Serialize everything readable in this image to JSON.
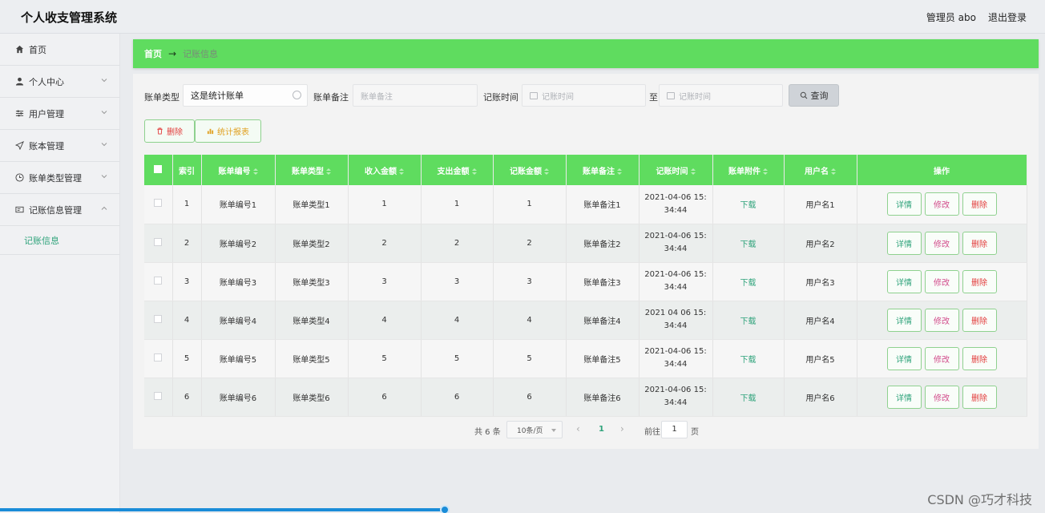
{
  "header": {
    "title": "个人收支管理系统",
    "admin": "管理员 abo",
    "logout": "退出登录"
  },
  "sidebar": {
    "items": [
      {
        "label": "首页",
        "icon": "home-icon"
      },
      {
        "label": "个人中心",
        "icon": "user-icon"
      },
      {
        "label": "用户管理",
        "icon": "sliders-icon"
      },
      {
        "label": "账本管理",
        "icon": "send-icon"
      },
      {
        "label": "账单类型管理",
        "icon": "clock-icon"
      },
      {
        "label": "记账信息管理",
        "icon": "card-icon"
      }
    ],
    "sub_item": "记账信息"
  },
  "breadcrumb": {
    "home": "首页",
    "arrow": "→",
    "current": "记账信息"
  },
  "search": {
    "type_label": "账单类型",
    "type_value": "这是统计账单",
    "remark_label": "账单备注",
    "remark_placeholder": "账单备注",
    "time_label": "记账时间",
    "time_start_placeholder": "记账时间",
    "to_label": "至",
    "time_end_placeholder": "记账时间",
    "query_label": "查询"
  },
  "actions": {
    "delete_label": "删除",
    "stats_label": "统计报表"
  },
  "table": {
    "headers": [
      "索引",
      "账单编号",
      "账单类型",
      "收入金额",
      "支出金额",
      "记账金额",
      "账单备注",
      "记账时间",
      "账单附件",
      "用户名",
      "操作"
    ],
    "rows": [
      {
        "index": "1",
        "no": "账单编号1",
        "type": "账单类型1",
        "income": "1",
        "expense": "1",
        "amount": "1",
        "remark": "账单备注1",
        "time1": "2021-04-06 15:",
        "time2": "34:44",
        "attach": "下载",
        "user": "用户名1"
      },
      {
        "index": "2",
        "no": "账单编号2",
        "type": "账单类型2",
        "income": "2",
        "expense": "2",
        "amount": "2",
        "remark": "账单备注2",
        "time1": "2021-04-06 15:",
        "time2": "34:44",
        "attach": "下载",
        "user": "用户名2"
      },
      {
        "index": "3",
        "no": "账单编号3",
        "type": "账单类型3",
        "income": "3",
        "expense": "3",
        "amount": "3",
        "remark": "账单备注3",
        "time1": "2021-04-06 15:",
        "time2": "34:44",
        "attach": "下载",
        "user": "用户名3"
      },
      {
        "index": "4",
        "no": "账单编号4",
        "type": "账单类型4",
        "income": "4",
        "expense": "4",
        "amount": "4",
        "remark": "账单备注4",
        "time1": "2021 04 06 15:",
        "time2": "34:44",
        "attach": "下载",
        "user": "用户名4"
      },
      {
        "index": "5",
        "no": "账单编号5",
        "type": "账单类型5",
        "income": "5",
        "expense": "5",
        "amount": "5",
        "remark": "账单备注5",
        "time1": "2021-04-06 15:",
        "time2": "34:44",
        "attach": "下载",
        "user": "用户名5"
      },
      {
        "index": "6",
        "no": "账单编号6",
        "type": "账单类型6",
        "income": "6",
        "expense": "6",
        "amount": "6",
        "remark": "账单备注6",
        "time1": "2021-04-06 15:",
        "time2": "34:44",
        "attach": "下载",
        "user": "用户名6"
      }
    ],
    "op_detail": "详情",
    "op_edit": "修改",
    "op_delete": "删除"
  },
  "pager": {
    "total": "共 6 条",
    "page_size": "10条/页",
    "prev": "‹",
    "current": "1",
    "next": "›",
    "goto": "前往",
    "goto_value": "1",
    "unit": "页"
  },
  "watermark": "CSDN @巧才科技",
  "colors": {
    "accent": "#5fdc5f",
    "link": "#2fa37b",
    "danger": "#e23b3b",
    "edit": "#d24c8c",
    "warning": "#e0a020",
    "progress": "#1a8cd8"
  }
}
